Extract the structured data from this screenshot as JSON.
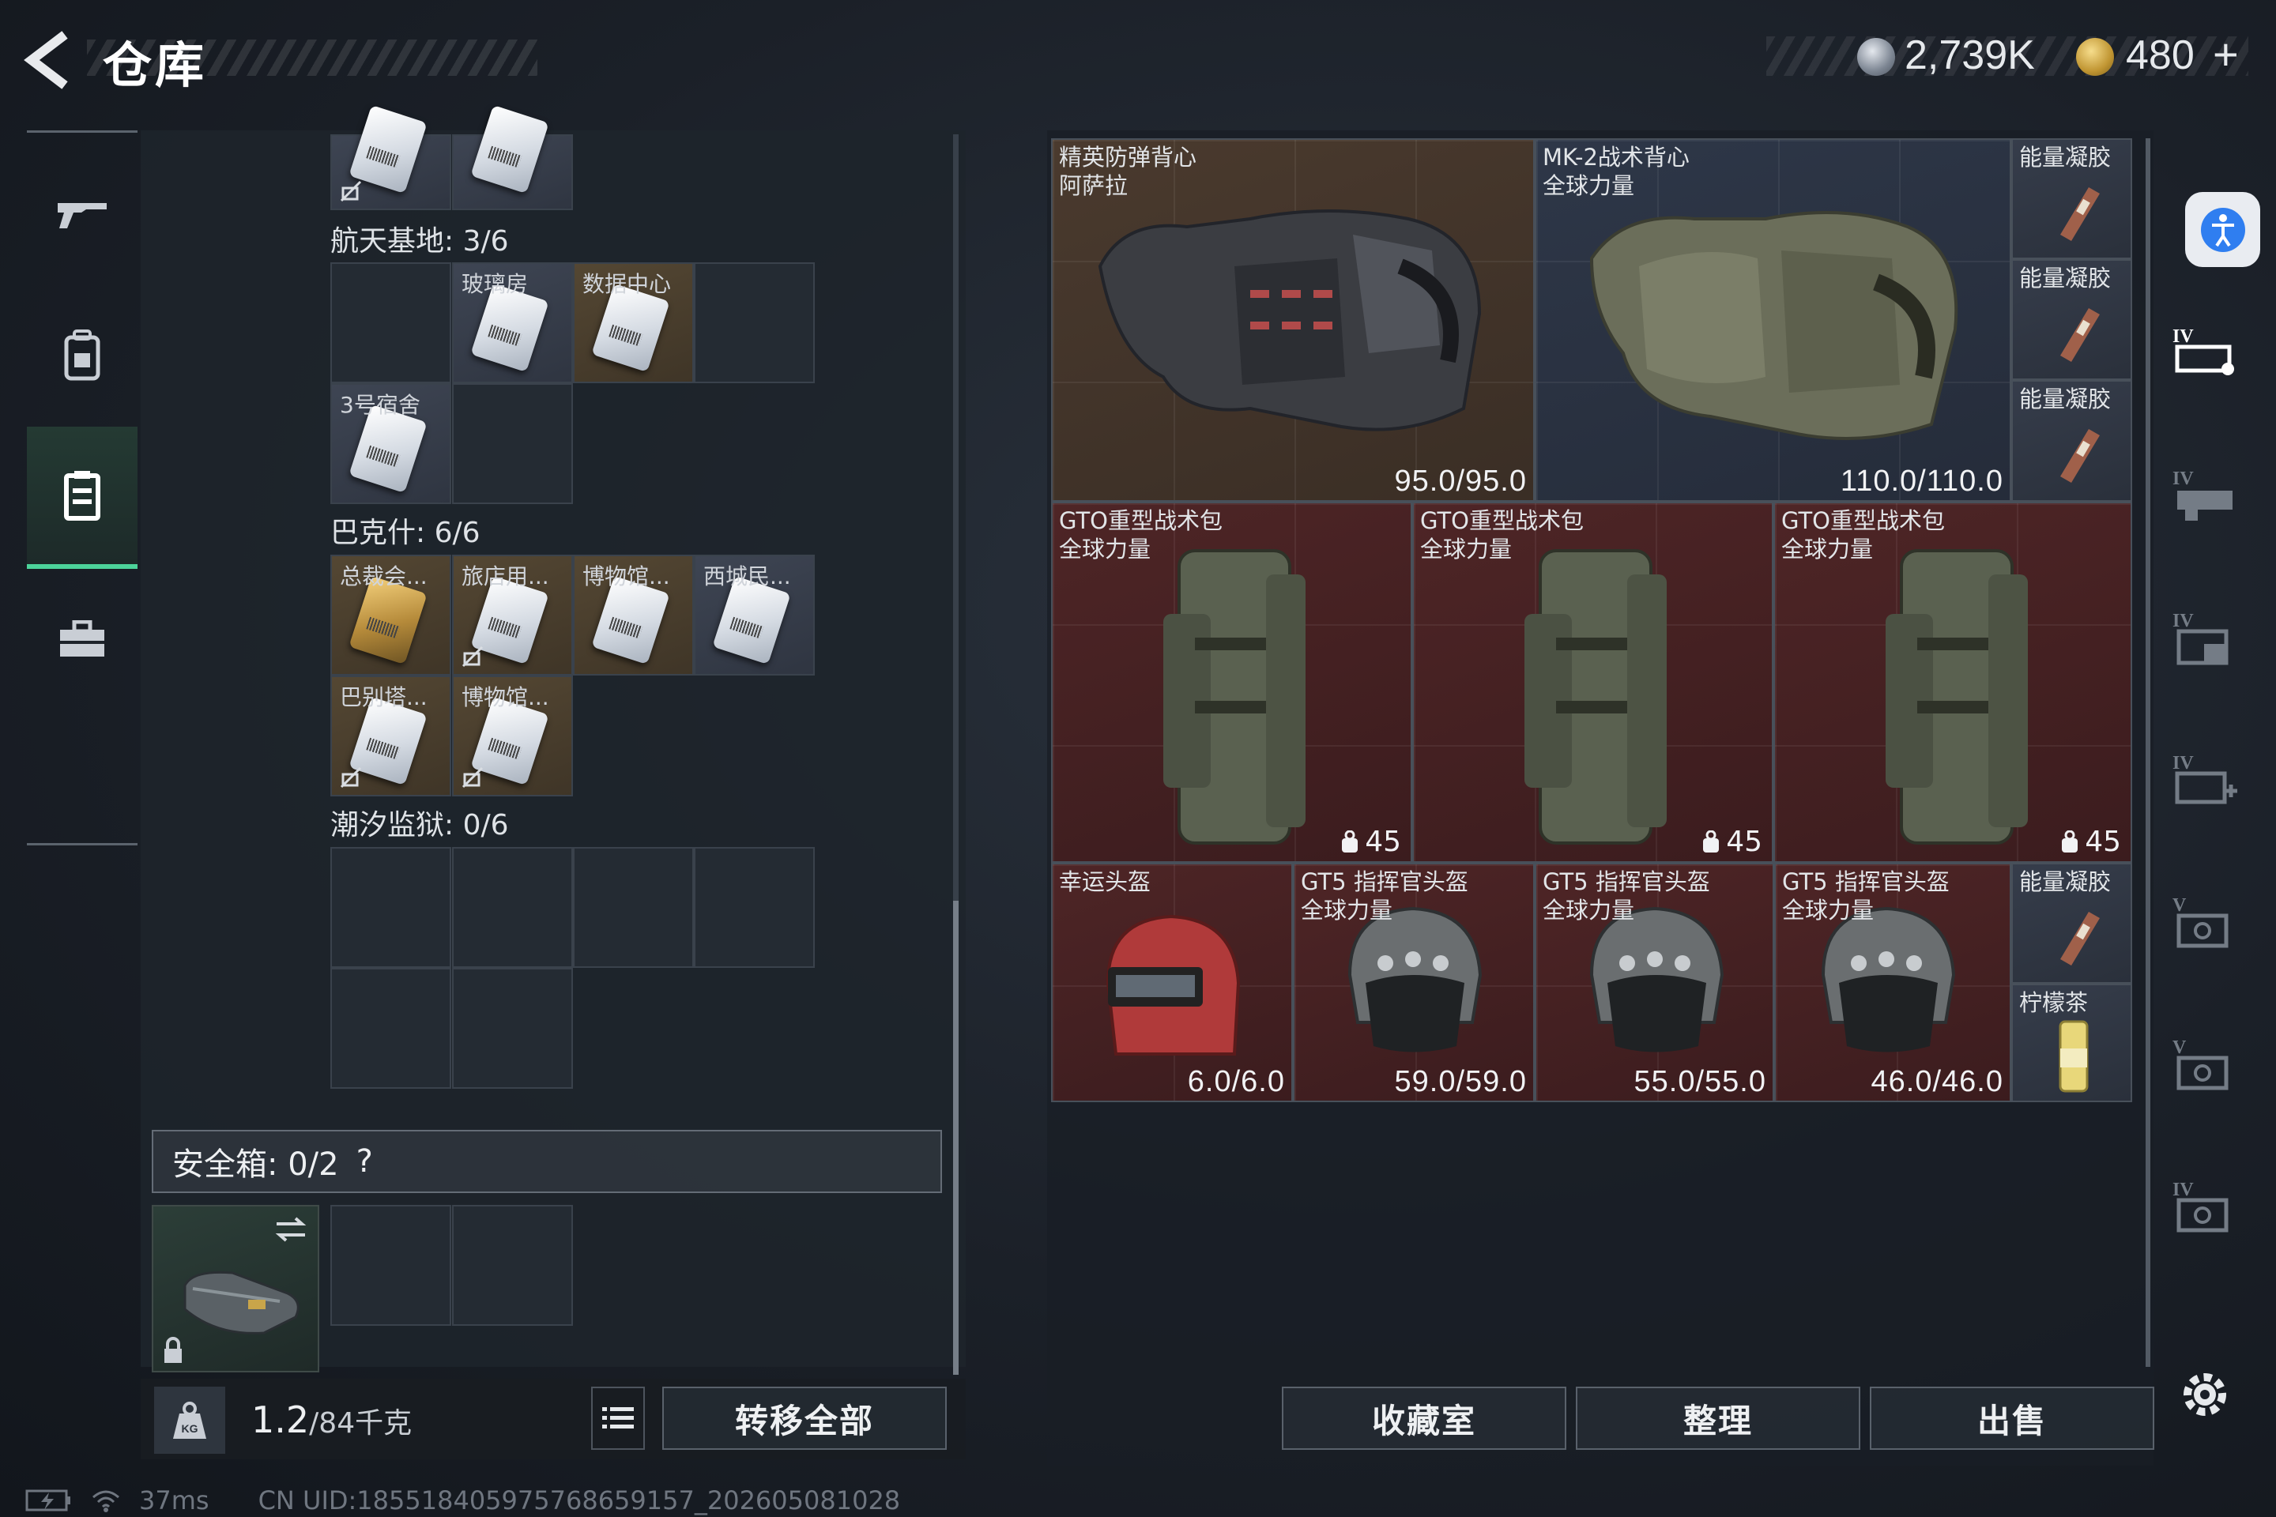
{
  "header": {
    "title": "仓库",
    "currency_silver": "2,739K",
    "currency_gold": "480",
    "currency_add": "+"
  },
  "left_nav": [
    {
      "icon": "rifle-icon"
    },
    {
      "icon": "backpack-icon"
    },
    {
      "icon": "storage-case-icon"
    },
    {
      "icon": "toolbox-icon"
    }
  ],
  "regions": {
    "r1": "航天基地: 3/6",
    "r2": "巴克什: 6/6",
    "r3": "潮汐监狱: 0/6"
  },
  "cards": {
    "glasshouse": "玻璃房",
    "datacenter": "数据中心",
    "dorm3": "3号宿舍",
    "presidential": "总裁会...",
    "hotel": "旅店用...",
    "museum1": "博物馆...",
    "westcity": "西城民...",
    "villa": "巴别塔...",
    "museum2": "博物馆..."
  },
  "safebox": {
    "label": "安全箱: 0/2",
    "help": "?"
  },
  "weight": {
    "value": "1.2",
    "total": "/84千克"
  },
  "buttons": {
    "transfer_all": "转移全部",
    "collection": "收藏室",
    "organize": "整理",
    "sell": "出售"
  },
  "items": {
    "vest1": {
      "name1": "精英防弹背心",
      "name2": "阿萨拉",
      "durability": "95.0/95.0"
    },
    "vest2": {
      "name1": "MK-2战术背心",
      "name2": "全球力量",
      "durability": "110.0/110.0"
    },
    "gel1": {
      "name": "能量凝胶"
    },
    "gel2": {
      "name": "能量凝胶"
    },
    "gel3": {
      "name": "能量凝胶"
    },
    "bag1": {
      "name1": "GTO重型战术包",
      "name2": "全球力量",
      "capacity": "45"
    },
    "bag2": {
      "name1": "GTO重型战术包",
      "name2": "全球力量",
      "capacity": "45"
    },
    "bag3": {
      "name1": "GTO重型战术包",
      "name2": "全球力量",
      "capacity": "45"
    },
    "helmet1": {
      "name1": "幸运头盔",
      "durability": "6.0/6.0"
    },
    "helmet2": {
      "name1": "GT5 指挥官头盔",
      "name2": "全球力量",
      "durability": "59.0/59.0"
    },
    "helmet3": {
      "name1": "GT5 指挥官头盔",
      "name2": "全球力量",
      "durability": "55.0/55.0"
    },
    "helmet4": {
      "name1": "GT5 指挥官头盔",
      "name2": "全球力量",
      "durability": "46.0/46.0"
    },
    "gel4": {
      "name": "能量凝胶"
    },
    "tea": {
      "name": "柠檬茶"
    }
  },
  "right_tabs": [
    "IV",
    "IV",
    "IV",
    "IV",
    "V",
    "V",
    "IV"
  ],
  "status": {
    "ping": "37ms",
    "uid": "CN UID:18551840597576865915​7_202605081028"
  }
}
